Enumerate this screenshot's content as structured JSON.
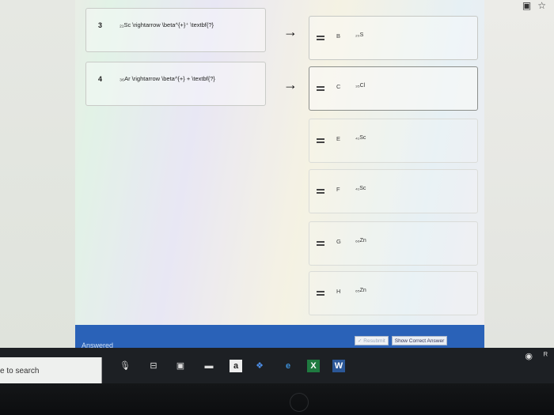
{
  "browser": {
    "icons": [
      "window-icon",
      "star-icon"
    ]
  },
  "prompts": [
    {
      "number": "3",
      "text": "₂₁Sc \\rightarrow \\beta^{+}⁺ \\textbf{?}"
    },
    {
      "number": "4",
      "text": "₃₆Ar \\rightarrow \\beta^{+} + \\textbf{?}"
    }
  ],
  "answers": [
    {
      "letter": "B",
      "text": "₂₀S"
    },
    {
      "letter": "C",
      "text": "₃₅Cl"
    },
    {
      "letter": "E",
      "text": "₄₁Sc"
    },
    {
      "letter": "F",
      "text": "₄₁Sc"
    },
    {
      "letter": "G",
      "text": "₆₆Zn"
    },
    {
      "letter": "H",
      "text": "₆₅Zn"
    }
  ],
  "status": {
    "answered": "Answered"
  },
  "actions": {
    "resubmit": "Resubmit",
    "show_correct": "Show Correct Answer"
  },
  "taskbar": {
    "search_text": "e to search",
    "amazon_letter": "a",
    "word_letter": "W",
    "excel_letter": "X"
  },
  "device": {
    "logo": "hp"
  }
}
